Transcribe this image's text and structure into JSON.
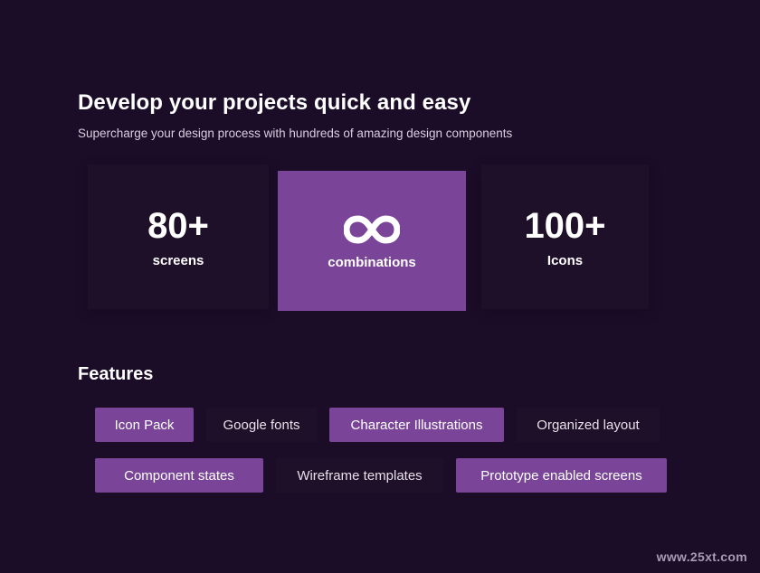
{
  "header": {
    "title": "Develop your projects quick and easy",
    "subtitle": "Supercharge your design process with hundreds of amazing design components"
  },
  "stats": [
    {
      "value": "80+",
      "label": "screens",
      "active": false
    },
    {
      "value": "",
      "icon": "infinity-icon",
      "label": "combinations",
      "active": true
    },
    {
      "value": "100+",
      "label": "Icons",
      "active": false
    }
  ],
  "features": {
    "title": "Features",
    "tags": [
      {
        "label": "Icon Pack",
        "style": "filled"
      },
      {
        "label": "Google fonts",
        "style": "plain"
      },
      {
        "label": "Character Illustrations",
        "style": "filled"
      },
      {
        "label": "Organized layout",
        "style": "plain"
      },
      {
        "label": "Component states",
        "style": "filled"
      },
      {
        "label": "Wireframe templates",
        "style": "plain"
      },
      {
        "label": "Prototype enabled screens",
        "style": "filled"
      }
    ]
  },
  "watermark": "www.25xt.com",
  "colors": {
    "background": "#1b0c27",
    "accent": "#7a4598",
    "card": "#1f1029"
  }
}
